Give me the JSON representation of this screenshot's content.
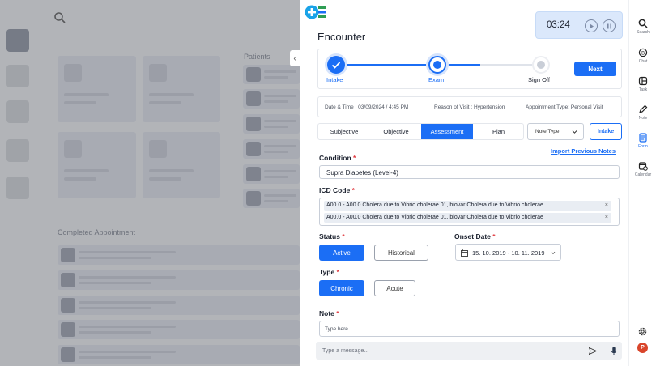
{
  "background": {
    "patients_label": "Patients",
    "completed_label": "Completed Appointment"
  },
  "encounter": {
    "title": "Encounter",
    "timer": "03:24",
    "steps": [
      {
        "label": "Intake",
        "state": "done"
      },
      {
        "label": "Exam",
        "state": "active"
      },
      {
        "label": "Sign Off",
        "state": "pending"
      }
    ],
    "next_label": "Next",
    "info": {
      "datetime": "Date & Time :  03/09/2024 / 4:45 PM",
      "reason": "Reason of Visit : Hypertension",
      "appointment": "Appointment Type: Personal Visit"
    },
    "tabs": [
      "Subjective",
      "Objective",
      "Assessment",
      "Plan"
    ],
    "active_tab": "Assessment",
    "note_type": "Note Type",
    "intake_button": "Intake",
    "import_link": "Import Previous Notes",
    "condition": {
      "label": "Condition",
      "value": "Supra Diabetes (Level-4)"
    },
    "icd": {
      "label": "ICD Code",
      "codes": [
        "A00.0 - A00.0 Cholera due to Vibrio cholerae 01, biovar  Cholera due to Vibrio cholerae",
        "A00.0 - A00.0 Cholera due to Vibrio cholerae 01, biovar  Cholera due to Vibrio cholerae"
      ],
      "remove": "×"
    },
    "status": {
      "label": "Status",
      "options": [
        "Active",
        "Historical"
      ],
      "selected": "Active"
    },
    "onset": {
      "label": "Onset Date",
      "value": "15. 10. 2019  -  10. 11. 2019"
    },
    "type": {
      "label": "Type",
      "options": [
        "Chronic",
        "Acute"
      ],
      "selected": "Chronic"
    },
    "note": {
      "label": "Note",
      "placeholder": "Type here..."
    },
    "message_placeholder": "Type a message..."
  },
  "rail": {
    "items": [
      {
        "label": "Search",
        "icon": "search-icon"
      },
      {
        "label": "Chat",
        "icon": "chat-icon"
      },
      {
        "label": "Task",
        "icon": "task-icon"
      },
      {
        "label": "Note",
        "icon": "note-icon"
      },
      {
        "label": "Form",
        "icon": "form-icon"
      },
      {
        "label": "Calendar",
        "icon": "calendar-icon"
      }
    ],
    "active": "Form",
    "avatar_initial": "P"
  },
  "colors": {
    "accent": "#1b6ef5",
    "required": "#e0383e",
    "avatar": "#d9452b"
  }
}
